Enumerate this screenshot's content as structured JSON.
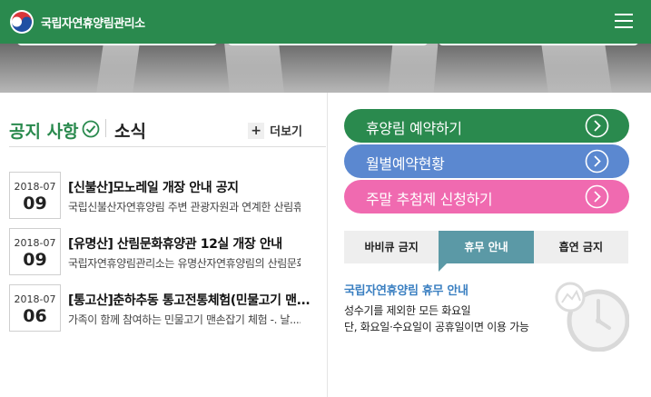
{
  "header": {
    "org_name": "국립자연휴양림관리소",
    "menu_icon": "hamburger-menu-icon",
    "logo_icon": "taegeuk-logo-icon",
    "brand_color": "#2a8a4e"
  },
  "notices": {
    "title": "공지 사항",
    "subtitle": "소식",
    "more_label": "더보기",
    "items": [
      {
        "date_ym": "2018-07",
        "date_d": "09",
        "title": "[신불산]모노레일 개장 안내 공지",
        "desc": "국립신불산자연휴양림 주변 관광자원과 연계한 산림휴양"
      },
      {
        "date_ym": "2018-07",
        "date_d": "09",
        "title": "[유명산] 산림문화휴양관 12실 개장 안내",
        "desc": "국립자연휴양림관리소는 유명산자연휴양림의 산림문화휴"
      },
      {
        "date_ym": "2018-07",
        "date_d": "06",
        "title": "[통고산]춘하추동 통고전통체험(민물고기 맨...",
        "desc": "가족이 함께 참여하는 민물고기 맨손잡기 체험 -. 날...."
      }
    ]
  },
  "quick_links": [
    {
      "label": "휴양림 예약하기",
      "color": "#2a8a4e"
    },
    {
      "label": "월별예약현황",
      "color": "#5b88d0"
    },
    {
      "label": "주말 추첨제 신청하기",
      "color": "#f06ab0"
    }
  ],
  "tabs": {
    "items": [
      "바비큐 금지",
      "휴무 안내",
      "흡연 금지"
    ],
    "active_index": 1
  },
  "info": {
    "title": "국립자연휴양림 휴무 안내",
    "line1": "성수기를 제외한 모든 화요일",
    "line2": "단, 화요일·수요일이 공휴일이면 이용 가능"
  }
}
